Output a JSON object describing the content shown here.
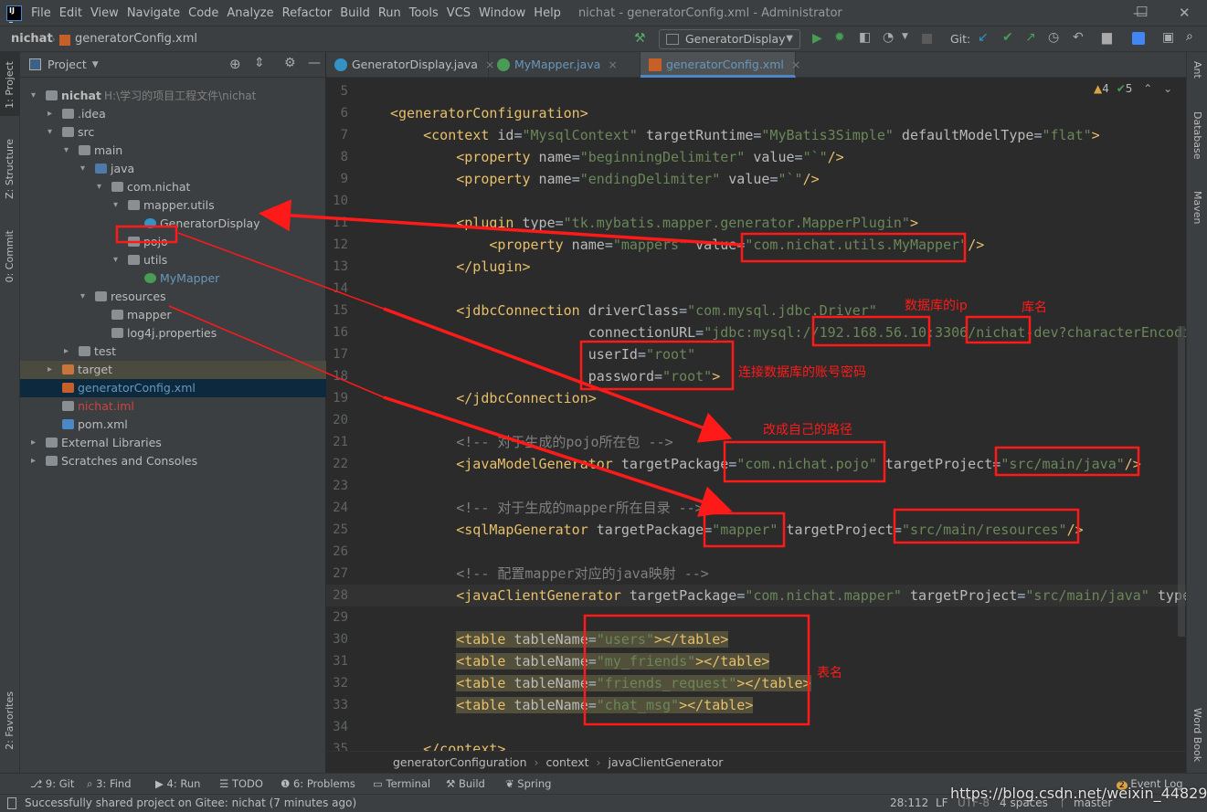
{
  "window": {
    "title": "nichat - generatorConfig.xml - Administrator",
    "minimize": "—",
    "maximize": "☐",
    "close": "✕"
  },
  "menu": [
    "File",
    "Edit",
    "View",
    "Navigate",
    "Code",
    "Analyze",
    "Refactor",
    "Build",
    "Run",
    "Tools",
    "VCS",
    "Window",
    "Help"
  ],
  "navbar": {
    "project": "nichat",
    "file": "generatorConfig.xml",
    "run_config": "GeneratorDisplay",
    "git_label": "Git:"
  },
  "left_strip": [
    "1: Project",
    "Z: Structure",
    "0: Commit",
    "2: Favorites"
  ],
  "right_strip": [
    "Ant",
    "Database",
    "Maven",
    "Word Book"
  ],
  "project_panel": {
    "title": "Project",
    "tree": [
      {
        "label": "nichat",
        "hint": "H:\\学习的项目工程文件\\nichat",
        "level": 0,
        "icon": "folder",
        "arrow": "▾",
        "bold": true
      },
      {
        "label": ".idea",
        "level": 1,
        "icon": "folder",
        "arrow": "▸"
      },
      {
        "label": "src",
        "level": 1,
        "icon": "folder",
        "arrow": "▾"
      },
      {
        "label": "main",
        "level": 2,
        "icon": "folder",
        "arrow": "▾"
      },
      {
        "label": "java",
        "level": 3,
        "icon": "folder-blue",
        "arrow": "▾"
      },
      {
        "label": "com.nichat",
        "level": 4,
        "icon": "package",
        "arrow": "▾"
      },
      {
        "label": "mapper.utils",
        "level": 5,
        "icon": "package",
        "arrow": "▾"
      },
      {
        "label": "GeneratorDisplay",
        "level": 6,
        "icon": "class"
      },
      {
        "label": "pojo",
        "level": 5,
        "icon": "package"
      },
      {
        "label": "utils",
        "level": 5,
        "icon": "package",
        "arrow": "▾"
      },
      {
        "label": "MyMapper",
        "level": 6,
        "icon": "interface",
        "color": "#6897bb"
      },
      {
        "label": "resources",
        "level": 3,
        "icon": "folder-res",
        "arrow": "▾"
      },
      {
        "label": "mapper",
        "level": 4,
        "icon": "folder"
      },
      {
        "label": "log4j.properties",
        "level": 4,
        "icon": "properties"
      },
      {
        "label": "test",
        "level": 2,
        "icon": "folder",
        "arrow": "▸"
      },
      {
        "label": "target",
        "level": 1,
        "icon": "folder-orange",
        "arrow": "▸",
        "row": "target"
      },
      {
        "label": "generatorConfig.xml",
        "level": 1,
        "icon": "xml",
        "color": "#6897bb",
        "row": "selected"
      },
      {
        "label": "nichat.iml",
        "level": 1,
        "icon": "iml",
        "color": "#cc4444"
      },
      {
        "label": "pom.xml",
        "level": 1,
        "icon": "maven"
      },
      {
        "label": "External Libraries",
        "level": 0,
        "icon": "libraries",
        "arrow": "▸"
      },
      {
        "label": "Scratches and Consoles",
        "level": 0,
        "icon": "scratches",
        "arrow": "▸"
      }
    ]
  },
  "tabs": [
    {
      "label": "GeneratorDisplay.java",
      "icon": "class",
      "color": "#bbbbbb"
    },
    {
      "label": "MyMapper.java",
      "icon": "interface",
      "color": "#6897bb"
    },
    {
      "label": "generatorConfig.xml",
      "icon": "xml",
      "color": "#6897bb",
      "active": true
    }
  ],
  "inspections": {
    "warnings": "4",
    "weak_warnings": "5"
  },
  "code": [
    {
      "n": "5",
      "t": []
    },
    {
      "n": "6",
      "t": [
        [
          "tag",
          "<generatorConfiguration>"
        ]
      ]
    },
    {
      "n": "7",
      "t": [
        [
          "pl",
          "    "
        ],
        [
          "tag",
          "<context"
        ],
        [
          "attr",
          " id"
        ],
        [
          "pl",
          "="
        ],
        [
          "val",
          "\"MysqlContext\""
        ],
        [
          "attr",
          " targetRuntime"
        ],
        [
          "pl",
          "="
        ],
        [
          "val",
          "\"MyBatis3Simple\""
        ],
        [
          "attr",
          " defaultModelType"
        ],
        [
          "pl",
          "="
        ],
        [
          "val",
          "\"flat\""
        ],
        [
          "tag",
          ">"
        ]
      ]
    },
    {
      "n": "8",
      "t": [
        [
          "pl",
          "        "
        ],
        [
          "tag",
          "<property"
        ],
        [
          "attr",
          " name"
        ],
        [
          "pl",
          "="
        ],
        [
          "val",
          "\"beginningDelimiter\""
        ],
        [
          "attr",
          " value"
        ],
        [
          "pl",
          "="
        ],
        [
          "val",
          "\"`\""
        ],
        [
          "tag",
          "/>"
        ]
      ]
    },
    {
      "n": "9",
      "t": [
        [
          "pl",
          "        "
        ],
        [
          "tag",
          "<property"
        ],
        [
          "attr",
          " name"
        ],
        [
          "pl",
          "="
        ],
        [
          "val",
          "\"endingDelimiter\""
        ],
        [
          "attr",
          " value"
        ],
        [
          "pl",
          "="
        ],
        [
          "val",
          "\"`\""
        ],
        [
          "tag",
          "/>"
        ]
      ]
    },
    {
      "n": "10",
      "t": []
    },
    {
      "n": "11",
      "t": [
        [
          "pl",
          "        "
        ],
        [
          "tag",
          "<plugin"
        ],
        [
          "attr",
          " type"
        ],
        [
          "pl",
          "="
        ],
        [
          "val",
          "\"tk.mybatis.mapper.generator.MapperPlugin\""
        ],
        [
          "tag",
          ">"
        ]
      ]
    },
    {
      "n": "12",
      "t": [
        [
          "pl",
          "            "
        ],
        [
          "tag",
          "<property"
        ],
        [
          "attr",
          " name"
        ],
        [
          "pl",
          "="
        ],
        [
          "val",
          "\"mappers\""
        ],
        [
          "attr",
          " value"
        ],
        [
          "pl",
          "="
        ],
        [
          "val",
          "\"com.nichat.utils.MyMapper\""
        ],
        [
          "tag",
          "/>"
        ]
      ]
    },
    {
      "n": "13",
      "t": [
        [
          "pl",
          "        "
        ],
        [
          "tag",
          "</plugin>"
        ]
      ]
    },
    {
      "n": "14",
      "t": []
    },
    {
      "n": "15",
      "t": [
        [
          "pl",
          "        "
        ],
        [
          "tag",
          "<jdbcConnection"
        ],
        [
          "attr",
          " driverClass"
        ],
        [
          "pl",
          "="
        ],
        [
          "val",
          "\"com.mysql.jdbc.Driver\""
        ]
      ]
    },
    {
      "n": "16",
      "t": [
        [
          "pl",
          "                        "
        ],
        [
          "attr",
          "connectionURL"
        ],
        [
          "pl",
          "="
        ],
        [
          "val",
          "\"jdbc:mysql://192.168.56.10:3306/nichat-dev?characterEncodi"
        ]
      ]
    },
    {
      "n": "17",
      "t": [
        [
          "pl",
          "                        "
        ],
        [
          "attr",
          "userId"
        ],
        [
          "pl",
          "="
        ],
        [
          "val",
          "\"root\""
        ]
      ]
    },
    {
      "n": "18",
      "t": [
        [
          "pl",
          "                        "
        ],
        [
          "attr",
          "password"
        ],
        [
          "pl",
          "="
        ],
        [
          "val",
          "\"root\""
        ],
        [
          "tag",
          ">"
        ]
      ]
    },
    {
      "n": "19",
      "t": [
        [
          "pl",
          "        "
        ],
        [
          "tag",
          "</jdbcConnection>"
        ]
      ]
    },
    {
      "n": "20",
      "t": []
    },
    {
      "n": "21",
      "t": [
        [
          "pl",
          "        "
        ],
        [
          "com",
          "<!-- 对于生成的pojo所在包 -->"
        ]
      ]
    },
    {
      "n": "22",
      "t": [
        [
          "pl",
          "        "
        ],
        [
          "tag",
          "<javaModelGenerator"
        ],
        [
          "attr",
          " targetPackage"
        ],
        [
          "pl",
          "="
        ],
        [
          "val",
          "\"com.nichat.pojo\""
        ],
        [
          "attr",
          " targetProject"
        ],
        [
          "pl",
          "="
        ],
        [
          "val",
          "\"src/main/java\""
        ],
        [
          "tag",
          "/>"
        ]
      ]
    },
    {
      "n": "23",
      "t": []
    },
    {
      "n": "24",
      "t": [
        [
          "pl",
          "        "
        ],
        [
          "com",
          "<!-- 对于生成的mapper所在目录 -->"
        ]
      ]
    },
    {
      "n": "25",
      "t": [
        [
          "pl",
          "        "
        ],
        [
          "tag",
          "<sqlMapGenerator"
        ],
        [
          "attr",
          " targetPackage"
        ],
        [
          "pl",
          "="
        ],
        [
          "val",
          "\"mapper\""
        ],
        [
          "attr",
          " targetProject"
        ],
        [
          "pl",
          "="
        ],
        [
          "val",
          "\"src/main/resources\""
        ],
        [
          "tag",
          "/>"
        ]
      ]
    },
    {
      "n": "26",
      "t": []
    },
    {
      "n": "27",
      "t": [
        [
          "pl",
          "        "
        ],
        [
          "com",
          "<!-- 配置mapper对应的java映射 -->"
        ]
      ]
    },
    {
      "n": "28",
      "t": [
        [
          "pl",
          "        "
        ],
        [
          "tag",
          "<javaClientGenerator"
        ],
        [
          "attr",
          " targetPackage"
        ],
        [
          "pl",
          "="
        ],
        [
          "val",
          "\"com.nichat.mapper\""
        ],
        [
          "attr",
          " targetProject"
        ],
        [
          "pl",
          "="
        ],
        [
          "val",
          "\"src/main/java\""
        ],
        [
          "attr",
          " type"
        ]
      ],
      "current": true
    },
    {
      "n": "29",
      "t": []
    },
    {
      "n": "30",
      "t": [
        [
          "pl",
          "        "
        ],
        [
          "tag",
          "<table"
        ],
        [
          "attr",
          " tableName"
        ],
        [
          "pl",
          "="
        ],
        [
          "val",
          "\"users\""
        ],
        [
          "tag",
          "></table>"
        ]
      ],
      "hl": true
    },
    {
      "n": "31",
      "t": [
        [
          "pl",
          "        "
        ],
        [
          "tag",
          "<table"
        ],
        [
          "attr",
          " tableName"
        ],
        [
          "pl",
          "="
        ],
        [
          "val",
          "\"my_friends\""
        ],
        [
          "tag",
          "></table>"
        ]
      ],
      "hl": true
    },
    {
      "n": "32",
      "t": [
        [
          "pl",
          "        "
        ],
        [
          "tag",
          "<table"
        ],
        [
          "attr",
          " tableName"
        ],
        [
          "pl",
          "="
        ],
        [
          "val",
          "\"friends_request\""
        ],
        [
          "tag",
          "></table>"
        ]
      ],
      "hl": true
    },
    {
      "n": "33",
      "t": [
        [
          "pl",
          "        "
        ],
        [
          "tag",
          "<table"
        ],
        [
          "attr",
          " tableName"
        ],
        [
          "pl",
          "="
        ],
        [
          "val",
          "\"chat_msg\""
        ],
        [
          "tag",
          "></table>"
        ]
      ],
      "hl": true
    },
    {
      "n": "34",
      "t": []
    },
    {
      "n": "35",
      "t": [
        [
          "pl",
          "    "
        ],
        [
          "tag",
          "</context>"
        ]
      ]
    }
  ],
  "breadcrumbs": [
    "generatorConfiguration",
    "context",
    "javaClientGenerator"
  ],
  "tool_windows": [
    "9: Git",
    "3: Find",
    "4: Run",
    "TODO",
    "6: Problems",
    "Terminal",
    "Build",
    "Spring"
  ],
  "event_log": {
    "label": "Event Log",
    "count": "2"
  },
  "status": {
    "message": "Successfully shared project on Gitee: nichat (7 minutes ago)",
    "position": "28:112",
    "line_sep": "LF",
    "encoding": "UTF-8",
    "indent": "4 spaces",
    "branch": "master"
  },
  "watermark": "https://blog.csdn.net/weixin_44829930",
  "annotations": {
    "ip": "数据库的ip",
    "dbname": "库名",
    "account": "连接数据库的账号密码",
    "path": "改成自己的路径",
    "tables": "表名"
  },
  "colors": {
    "annotation": "#ff1a1a",
    "tag": "#e8bf6a",
    "value": "#6a8759",
    "accent": "#4a88c7"
  }
}
